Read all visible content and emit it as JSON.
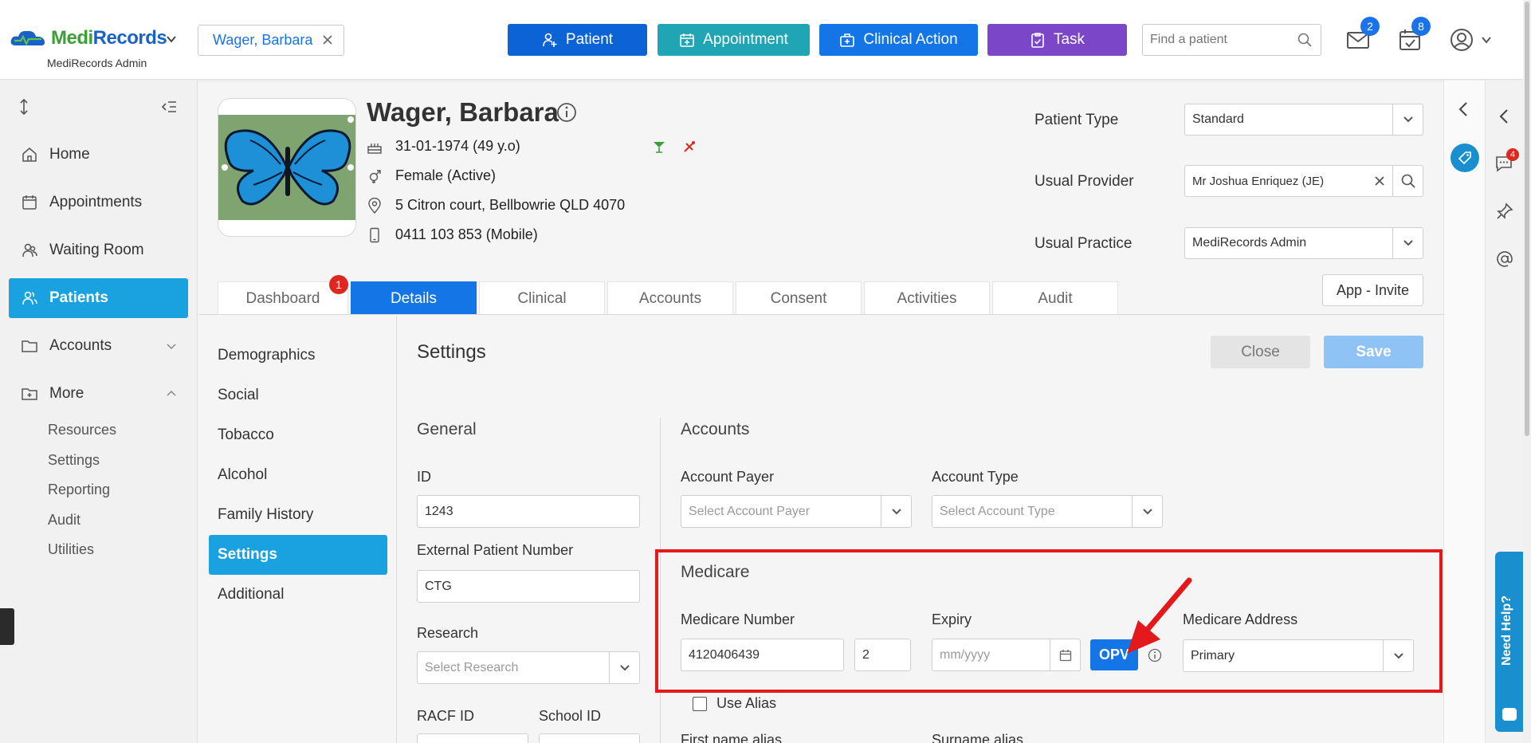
{
  "header": {
    "logo_part1": "Medi",
    "logo_part2": "Records",
    "org_name": "MediRecords Admin",
    "open_tab": "Wager, Barbara",
    "buttons": {
      "patient": "Patient",
      "appointment": "Appointment",
      "clinical_action": "Clinical Action",
      "task": "Task"
    },
    "search_placeholder": "Find a patient",
    "mail_count": "2",
    "tasks_count": "8"
  },
  "sidebar": {
    "items": [
      {
        "label": "Home"
      },
      {
        "label": "Appointments"
      },
      {
        "label": "Waiting Room"
      },
      {
        "label": "Patients"
      },
      {
        "label": "Accounts"
      },
      {
        "label": "More"
      }
    ],
    "more_sub": [
      "Resources",
      "Settings",
      "Reporting",
      "Audit",
      "Utilities"
    ]
  },
  "patient": {
    "name": "Wager, Barbara",
    "dob": "31-01-1974 (49 y.o)",
    "gender": "Female (Active)",
    "address": "5 Citron court, Bellbowrie QLD 4070",
    "phone": "0411 103 853 (Mobile)"
  },
  "patient_meta": {
    "patient_type_label": "Patient Type",
    "patient_type_value": "Standard",
    "usual_provider_label": "Usual Provider",
    "usual_provider_value": "Mr Joshua Enriquez (JE)",
    "usual_practice_label": "Usual Practice",
    "usual_practice_value": "MediRecords Admin"
  },
  "tabs": [
    {
      "label": "Dashboard",
      "badge": "1"
    },
    {
      "label": "Details"
    },
    {
      "label": "Clinical"
    },
    {
      "label": "Accounts"
    },
    {
      "label": "Consent"
    },
    {
      "label": "Activities"
    },
    {
      "label": "Audit"
    }
  ],
  "app_invite": "App - Invite",
  "details_nav": [
    "Demographics",
    "Social",
    "Tobacco",
    "Alcohol",
    "Family History",
    "Settings",
    "Additional"
  ],
  "settings": {
    "title": "Settings",
    "close": "Close",
    "save": "Save",
    "general": {
      "title": "General",
      "id_label": "ID",
      "id_value": "1243",
      "ext_label": "External Patient Number",
      "ext_value": "CTG",
      "research_label": "Research",
      "research_placeholder": "Select Research",
      "racf_label": "RACF ID",
      "school_label": "School ID"
    },
    "accounts": {
      "title": "Accounts",
      "payer_label": "Account Payer",
      "payer_placeholder": "Select Account Payer",
      "type_label": "Account Type",
      "type_placeholder": "Select Account Type"
    },
    "medicare": {
      "title": "Medicare",
      "number_label": "Medicare Number",
      "number_value": "4120406439",
      "irn_value": "2",
      "expiry_label": "Expiry",
      "expiry_placeholder": "mm/yyyy",
      "opv": "OPV",
      "address_label": "Medicare Address",
      "address_value": "Primary",
      "use_alias": "Use Alias",
      "first_alias": "First name alias",
      "surname_alias": "Surname alias"
    }
  },
  "right_rail": {
    "chat_count": "4",
    "need_help": "Need Help?"
  },
  "colors": {
    "primary": "#1475e6",
    "active_nav": "#1aa1e0",
    "highlight": "#e3191c"
  }
}
